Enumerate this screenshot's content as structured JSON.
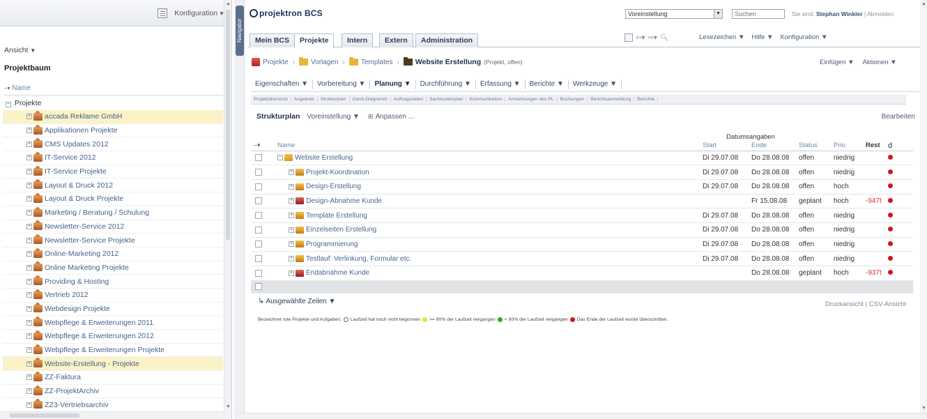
{
  "left_panel": {
    "config_menu": "Konfiguration",
    "view_menu": "Ansicht",
    "title": "Projektbaum",
    "column_header": "Name",
    "root": "Projekte",
    "items": [
      {
        "label": "accada Reklame GmbH",
        "highlight": true
      },
      {
        "label": "Applikationen Projekte",
        "highlight": false
      },
      {
        "label": "CMS Updates 2012",
        "highlight": false
      },
      {
        "label": "IT-Service 2012",
        "highlight": false
      },
      {
        "label": "IT-Service Projekte",
        "highlight": false
      },
      {
        "label": "Layout & Druck 2012",
        "highlight": false
      },
      {
        "label": "Layout & Druck Projekte",
        "highlight": false
      },
      {
        "label": "Marketing / Beratung / Schulung",
        "highlight": false
      },
      {
        "label": "Newsletter-Service 2012",
        "highlight": false
      },
      {
        "label": "Newsletter-Service Projekte",
        "highlight": false
      },
      {
        "label": "Online-Marketing 2012",
        "highlight": false
      },
      {
        "label": "Online Marketing Projekte",
        "highlight": false
      },
      {
        "label": "Providing & Hosting",
        "highlight": false
      },
      {
        "label": "Vertrieb 2012",
        "highlight": false
      },
      {
        "label": "Webdesign Projekte",
        "highlight": false
      },
      {
        "label": "Webpflege & Erweiterungen 2011",
        "highlight": false
      },
      {
        "label": "Webpflege & Erweiterungen 2012",
        "highlight": false
      },
      {
        "label": "Webpflege & Erweiterungen Projekte",
        "highlight": false
      },
      {
        "label": "Website-Erstellung - Projekte",
        "highlight": true
      },
      {
        "label": "ZZ-Faktura",
        "highlight": false
      },
      {
        "label": "ZZ-ProjektArchiv",
        "highlight": false
      },
      {
        "label": "ZZ3-Vertriebsarchiv",
        "highlight": false
      }
    ]
  },
  "navigator_label": "Navigator",
  "header": {
    "logo": "projektron BCS",
    "role_select": "Voreinstellung",
    "search_placeholder": "Suchen",
    "user_prefix": "Sie sind:",
    "user_name": "Stephan Winkler",
    "logout": "Abmelden",
    "tabs": [
      {
        "label": "Mein BCS",
        "active": false
      },
      {
        "label": "Projekte",
        "active": true
      },
      {
        "label": "Intern",
        "active": false
      },
      {
        "label": "Extern",
        "active": false
      },
      {
        "label": "Administration",
        "active": false
      }
    ],
    "menus": [
      "Lesezeichen ▼",
      "Hilfe ▼",
      "Konfiguration ▼"
    ]
  },
  "breadcrumb": {
    "items": [
      "Projekte",
      "Vorlagen",
      "Templates"
    ],
    "current": "Website Erstellung",
    "current_note": "(Projekt, offen)",
    "menus": [
      "Einfügen ▼",
      "Aktionen ▼"
    ]
  },
  "toolbar": {
    "items": [
      {
        "label": "Eigenschaften ▼",
        "active": false
      },
      {
        "label": "Vorbereitung ▼",
        "active": false
      },
      {
        "label": "Planung ▼",
        "active": true
      },
      {
        "label": "Durchführung ▼",
        "active": false
      },
      {
        "label": "Erfassung ▼",
        "active": false
      },
      {
        "label": "Berichte ▼",
        "active": false
      },
      {
        "label": "Werkzeuge ▼",
        "active": false
      }
    ],
    "subtabs": [
      "Projektübersicht",
      "Angebote",
      "Strukturplan",
      "Gantt-Diagramm",
      "Auftragsdaten",
      "Sachkostenplan",
      "Kommunikation",
      "Anmerkungen des PL",
      "Buchungen",
      "Berichtsanmeldung",
      "Berichte"
    ]
  },
  "view": {
    "title": "Strukturplan",
    "preset": "Voreinstellung ▼",
    "customize": "Anpassen ...",
    "edit": "Bearbeiten"
  },
  "grid": {
    "group_header": "Datumsangaben",
    "columns": [
      "Name",
      "Start",
      "Ende",
      "Status",
      "Prio",
      "Rest",
      "d"
    ],
    "rows": [
      {
        "name": "Website Erstellung",
        "indent": 0,
        "kind": "folder",
        "start": "Di 29.07.08",
        "end": "Do 28.08.08",
        "status": "offen",
        "prio": "niedrig",
        "rest": ""
      },
      {
        "name": "Projekt-Koordination",
        "indent": 1,
        "kind": "task",
        "start": "Di 29.07.08",
        "end": "Do 28.08.08",
        "status": "offen",
        "prio": "niedrig",
        "rest": ""
      },
      {
        "name": "Design-Erstellung",
        "indent": 1,
        "kind": "task",
        "start": "Di 29.07.08",
        "end": "Do 28.08.08",
        "status": "offen",
        "prio": "hoch",
        "rest": ""
      },
      {
        "name": "Design-Abnahme Kunde",
        "indent": 1,
        "kind": "milestone",
        "start": "",
        "end": "Fr 15.08.08",
        "status": "geplant",
        "prio": "hoch",
        "rest": "-947t"
      },
      {
        "name": "Template Erstellung",
        "indent": 1,
        "kind": "task",
        "start": "Di 29.07.08",
        "end": "Do 28.08.08",
        "status": "offen",
        "prio": "niedrig",
        "rest": ""
      },
      {
        "name": "Einzelseiten Erstellung",
        "indent": 1,
        "kind": "task",
        "start": "Di 29.07.08",
        "end": "Do 28.08.08",
        "status": "offen",
        "prio": "niedrig",
        "rest": ""
      },
      {
        "name": "Programmierung",
        "indent": 1,
        "kind": "task",
        "start": "Di 29.07.08",
        "end": "Do 28.08.08",
        "status": "offen",
        "prio": "niedrig",
        "rest": ""
      },
      {
        "name": "Testlauf: Verlinkung, Formular etc.",
        "indent": 1,
        "kind": "task",
        "start": "Di 29.07.08",
        "end": "Do 28.08.08",
        "status": "offen",
        "prio": "niedrig",
        "rest": ""
      },
      {
        "name": "Endabnahme Kunde",
        "indent": 1,
        "kind": "milestone",
        "start": "",
        "end": "Do 28.08.08",
        "status": "geplant",
        "prio": "hoch",
        "rest": "-937t"
      }
    ]
  },
  "footer": {
    "selected_rows": "Ausgewählte Zeilen ▼",
    "print_links": "Druckansicht | CSV-Ansicht",
    "legend_prefix": "Bezeichnet rote Projekte und Aufgaben:",
    "legend_items": [
      {
        "text": "Laufzeit hat noch nicht begonnen",
        "color": "#ffffff"
      },
      {
        "text": ">= 80% der Laufzeit vergangen",
        "color": "#e8e23a"
      },
      {
        "text": "< 80% der Laufzeit vergangen",
        "color": "#2fa52f"
      },
      {
        "text": "Das Ende der Laufzeit wurde überschritten.",
        "color": "#d3141c"
      }
    ]
  }
}
